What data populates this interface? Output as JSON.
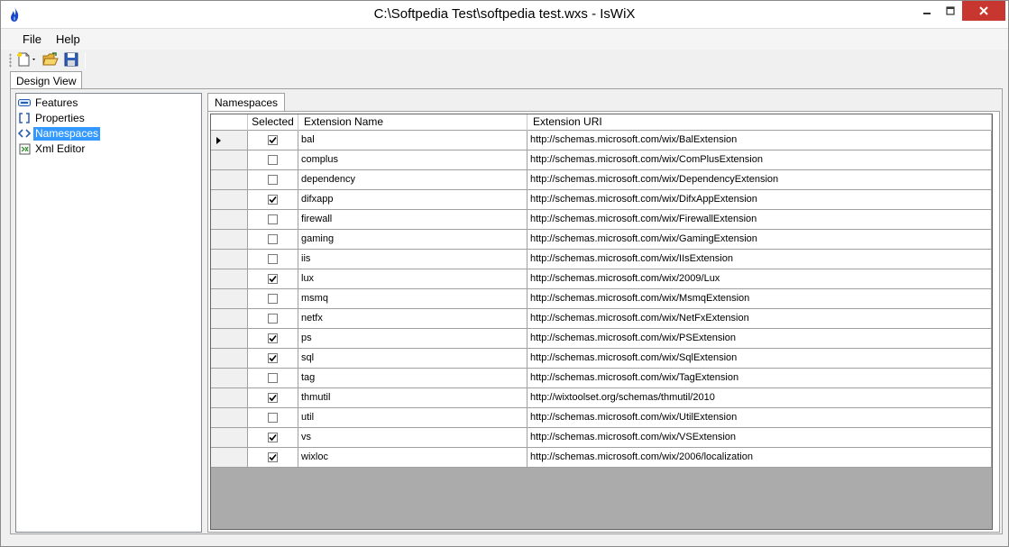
{
  "window": {
    "title": "C:\\Softpedia Test\\softpedia test.wxs - IsWiX",
    "app_icon": "flame-icon",
    "controls": [
      "minimize-icon",
      "maximize-icon",
      "close-icon"
    ],
    "close_color": "#c7372f"
  },
  "menu": {
    "file": "File",
    "help": "Help"
  },
  "toolbar": {
    "buttons": [
      "new-file-icon",
      "open-folder-icon",
      "save-icon"
    ]
  },
  "main_tab": {
    "label": "Design View"
  },
  "tree": {
    "items": [
      {
        "label": "Features",
        "icon": "features-icon",
        "selected": false
      },
      {
        "label": "Properties",
        "icon": "properties-icon",
        "selected": false
      },
      {
        "label": "Namespaces",
        "icon": "namespaces-icon",
        "selected": true
      },
      {
        "label": "Xml Editor",
        "icon": "xml-editor-icon",
        "selected": false
      }
    ],
    "selection_color": "#3399ff"
  },
  "ns_tab": {
    "label": "Namespaces"
  },
  "grid": {
    "columns": [
      "Selected",
      "Extension Name",
      "Extension URI"
    ],
    "rows": [
      {
        "selected": true,
        "name": "bal",
        "uri": "http://schemas.microsoft.com/wix/BalExtension"
      },
      {
        "selected": false,
        "name": "complus",
        "uri": "http://schemas.microsoft.com/wix/ComPlusExtension"
      },
      {
        "selected": false,
        "name": "dependency",
        "uri": "http://schemas.microsoft.com/wix/DependencyExtension"
      },
      {
        "selected": true,
        "name": "difxapp",
        "uri": "http://schemas.microsoft.com/wix/DifxAppExtension"
      },
      {
        "selected": false,
        "name": "firewall",
        "uri": "http://schemas.microsoft.com/wix/FirewallExtension"
      },
      {
        "selected": false,
        "name": "gaming",
        "uri": "http://schemas.microsoft.com/wix/GamingExtension"
      },
      {
        "selected": false,
        "name": "iis",
        "uri": "http://schemas.microsoft.com/wix/IIsExtension"
      },
      {
        "selected": true,
        "name": "lux",
        "uri": "http://schemas.microsoft.com/wix/2009/Lux"
      },
      {
        "selected": false,
        "name": "msmq",
        "uri": "http://schemas.microsoft.com/wix/MsmqExtension"
      },
      {
        "selected": false,
        "name": "netfx",
        "uri": "http://schemas.microsoft.com/wix/NetFxExtension"
      },
      {
        "selected": true,
        "name": "ps",
        "uri": "http://schemas.microsoft.com/wix/PSExtension"
      },
      {
        "selected": true,
        "name": "sql",
        "uri": "http://schemas.microsoft.com/wix/SqlExtension"
      },
      {
        "selected": false,
        "name": "tag",
        "uri": "http://schemas.microsoft.com/wix/TagExtension"
      },
      {
        "selected": true,
        "name": "thmutil",
        "uri": "http://wixtoolset.org/schemas/thmutil/2010"
      },
      {
        "selected": false,
        "name": "util",
        "uri": "http://schemas.microsoft.com/wix/UtilExtension"
      },
      {
        "selected": true,
        "name": "vs",
        "uri": "http://schemas.microsoft.com/wix/VSExtension"
      },
      {
        "selected": true,
        "name": "wixloc",
        "uri": "http://schemas.microsoft.com/wix/2006/localization"
      }
    ],
    "current_row": 0,
    "empty_area_color": "#ababab"
  }
}
